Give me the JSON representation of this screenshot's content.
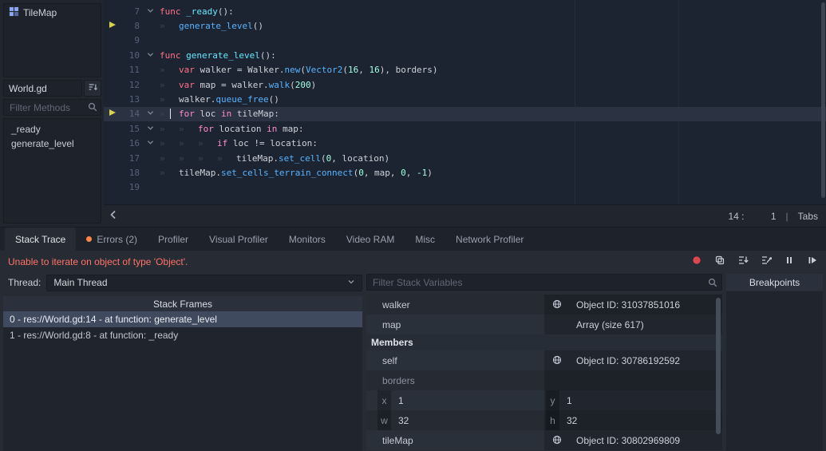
{
  "sidebar": {
    "scripts": [
      {
        "label": "TileMap",
        "icon": "tilemap-icon"
      }
    ],
    "current_script": "World.gd",
    "filter_methods_placeholder": "Filter Methods",
    "methods": [
      "_ready",
      "generate_level"
    ]
  },
  "editor": {
    "status": {
      "line": "14",
      "column": "1",
      "indent_type": "Tabs"
    },
    "lines": [
      {
        "num": 7,
        "indent": 0,
        "fold": true,
        "tokens": [
          {
            "c": "kw",
            "t": "func"
          },
          {
            "c": "txt",
            "t": " "
          },
          {
            "c": "fn",
            "t": "_ready"
          },
          {
            "c": "txt",
            "t": "():"
          }
        ]
      },
      {
        "num": 8,
        "indent": 1,
        "exec_marker": true,
        "tokens": [
          {
            "c": "call",
            "t": "generate_level"
          },
          {
            "c": "txt",
            "t": "()"
          }
        ]
      },
      {
        "num": 9,
        "indent": 0,
        "tokens": []
      },
      {
        "num": 10,
        "indent": 0,
        "fold": true,
        "tokens": [
          {
            "c": "kw",
            "t": "func"
          },
          {
            "c": "txt",
            "t": " "
          },
          {
            "c": "fn",
            "t": "generate_level"
          },
          {
            "c": "txt",
            "t": "():"
          }
        ]
      },
      {
        "num": 11,
        "indent": 1,
        "tokens": [
          {
            "c": "kw",
            "t": "var"
          },
          {
            "c": "txt",
            "t": " walker = Walker."
          },
          {
            "c": "call",
            "t": "new"
          },
          {
            "c": "txt",
            "t": "("
          },
          {
            "c": "call",
            "t": "Vector2"
          },
          {
            "c": "txt",
            "t": "("
          },
          {
            "c": "num",
            "t": "16"
          },
          {
            "c": "txt",
            "t": ", "
          },
          {
            "c": "num",
            "t": "16"
          },
          {
            "c": "txt",
            "t": "), borders)"
          }
        ]
      },
      {
        "num": 12,
        "indent": 1,
        "tokens": [
          {
            "c": "kw",
            "t": "var"
          },
          {
            "c": "txt",
            "t": " map = walker."
          },
          {
            "c": "call",
            "t": "walk"
          },
          {
            "c": "txt",
            "t": "("
          },
          {
            "c": "num",
            "t": "200"
          },
          {
            "c": "txt",
            "t": ")"
          }
        ]
      },
      {
        "num": 13,
        "indent": 1,
        "tokens": [
          {
            "c": "txt",
            "t": "walker."
          },
          {
            "c": "call",
            "t": "queue_free"
          },
          {
            "c": "txt",
            "t": "()"
          }
        ]
      },
      {
        "num": 14,
        "indent": 1,
        "fold": true,
        "exec_marker": true,
        "current": true,
        "caret": true,
        "tokens": [
          {
            "c": "ctrl",
            "t": "for"
          },
          {
            "c": "txt",
            "t": " loc "
          },
          {
            "c": "ctrl",
            "t": "in"
          },
          {
            "c": "txt",
            "t": " tileMap:"
          }
        ]
      },
      {
        "num": 15,
        "indent": 2,
        "fold": true,
        "tokens": [
          {
            "c": "ctrl",
            "t": "for"
          },
          {
            "c": "txt",
            "t": " location "
          },
          {
            "c": "ctrl",
            "t": "in"
          },
          {
            "c": "txt",
            "t": " map:"
          }
        ]
      },
      {
        "num": 16,
        "indent": 3,
        "fold": true,
        "tokens": [
          {
            "c": "ctrl",
            "t": "if"
          },
          {
            "c": "txt",
            "t": " loc != location:"
          }
        ]
      },
      {
        "num": 17,
        "indent": 4,
        "tokens": [
          {
            "c": "txt",
            "t": "tileMap."
          },
          {
            "c": "call",
            "t": "set_cell"
          },
          {
            "c": "txt",
            "t": "("
          },
          {
            "c": "num",
            "t": "0"
          },
          {
            "c": "txt",
            "t": ", location)"
          }
        ]
      },
      {
        "num": 18,
        "indent": 1,
        "tokens": [
          {
            "c": "txt",
            "t": "tileMap."
          },
          {
            "c": "call",
            "t": "set_cells_terrain_connect"
          },
          {
            "c": "txt",
            "t": "("
          },
          {
            "c": "num",
            "t": "0"
          },
          {
            "c": "txt",
            "t": ", map, "
          },
          {
            "c": "num",
            "t": "0"
          },
          {
            "c": "txt",
            "t": ", "
          },
          {
            "c": "num",
            "t": "-1"
          },
          {
            "c": "txt",
            "t": ")"
          }
        ]
      },
      {
        "num": 19,
        "indent": 0,
        "tokens": []
      }
    ]
  },
  "debugger": {
    "tabs": [
      {
        "label": "Stack Trace",
        "active": true
      },
      {
        "label": "Errors (2)",
        "dot": true
      },
      {
        "label": "Profiler"
      },
      {
        "label": "Visual Profiler"
      },
      {
        "label": "Monitors"
      },
      {
        "label": "Video RAM"
      },
      {
        "label": "Misc"
      },
      {
        "label": "Network Profiler"
      }
    ],
    "error_message": "Unable to iterate on object of type 'Object'.",
    "toolbar_buttons": [
      {
        "name": "skip-breakpoints-button",
        "icon": "record-icon"
      },
      {
        "name": "copy-error-button",
        "icon": "copy-icon"
      },
      {
        "name": "step-into-button",
        "icon": "step-into-icon"
      },
      {
        "name": "step-over-button",
        "icon": "step-over-icon"
      },
      {
        "name": "break-button",
        "icon": "pause-icon"
      },
      {
        "name": "continue-button",
        "icon": "continue-icon"
      }
    ],
    "thread_label": "Thread:",
    "thread_value": "Main Thread",
    "filter_placeholder": "Filter Stack Variables",
    "stack_frames_title": "Stack Frames",
    "stack_frames": [
      {
        "label": "0 - res://World.gd:14 - at function: generate_level",
        "selected": true
      },
      {
        "label": "1 - res://World.gd:8 - at function: _ready",
        "selected": false
      }
    ],
    "variables": [
      {
        "type": "var",
        "name": "walker",
        "object_icon": true,
        "value": "Object ID: 31037851016",
        "shade": 0
      },
      {
        "type": "var",
        "name": "map",
        "object_icon": false,
        "value": "Array (size 617)",
        "shade": 1
      },
      {
        "type": "header",
        "label": "Members"
      },
      {
        "type": "var",
        "name": "self",
        "object_icon": true,
        "value": "Object ID: 30786192592",
        "shade": 1
      },
      {
        "type": "var",
        "name": "borders",
        "object_icon": false,
        "value": "",
        "dim": true,
        "shade": 0
      },
      {
        "type": "pair",
        "cells": [
          {
            "k": "x",
            "v": "1"
          },
          {
            "k": "y",
            "v": "1"
          }
        ],
        "shade": 1
      },
      {
        "type": "pair",
        "cells": [
          {
            "k": "w",
            "v": "32"
          },
          {
            "k": "h",
            "v": "32"
          }
        ],
        "shade": 0
      },
      {
        "type": "var",
        "name": "tileMap",
        "object_icon": true,
        "value": "Object ID: 30802969809",
        "shade": 1
      }
    ],
    "breakpoints_title": "Breakpoints"
  },
  "colors": {
    "error_text": "#ff7368",
    "errors_tab_dot": "#ff8648",
    "execution_arrow": "#d9d34a",
    "skip_breakpoints_red": "#e0464e",
    "selected_frame_bg": "#404a5e",
    "syntax": {
      "keyword": "#ff7085",
      "control_flow": "#ff8ccc",
      "function_definition": "#66e6ff",
      "function_call": "#57b3ff",
      "number": "#a1ffe0",
      "text": "#ced2d8"
    }
  }
}
